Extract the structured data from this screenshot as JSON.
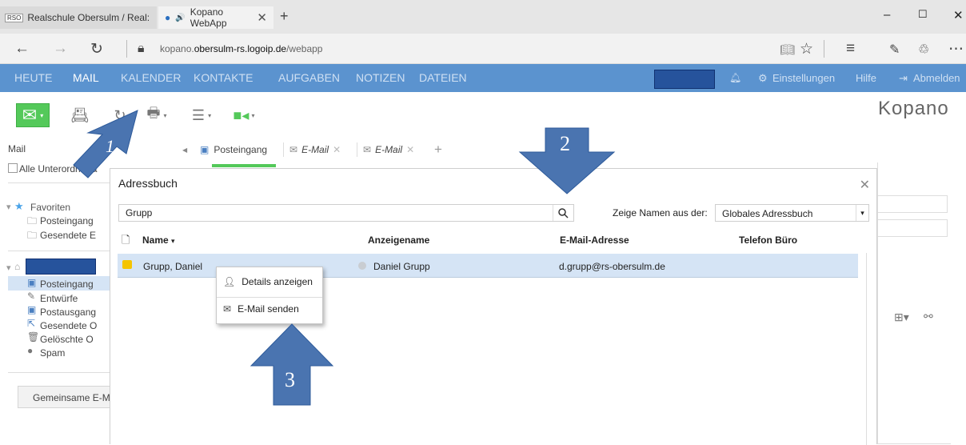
{
  "browser": {
    "tabs": [
      {
        "badge": "RSO",
        "title": "Realschule Obersulm / Real:"
      },
      {
        "title": "Kopano WebApp"
      }
    ],
    "url_prefix": "kopano.",
    "url_domain": "obersulm-rs.logoip.de",
    "url_suffix": "/webapp"
  },
  "menu": {
    "items": [
      "HEUTE",
      "MAIL",
      "KALENDER",
      "KONTAKTE",
      "AUFGABEN",
      "NOTIZEN",
      "DATEIEN"
    ],
    "active": "MAIL",
    "settings": "Einstellungen",
    "help": "Hilfe",
    "logout": "Abmelden"
  },
  "logo": "Kopano",
  "left_nav": {
    "title": "Mail",
    "all_subfolders": "Alle Unterordner a",
    "favorites": "Favoriten",
    "fav_items": [
      "Posteingang",
      "Gesendete E"
    ],
    "folders": [
      "Posteingang",
      "Entwürfe",
      "Postausgang",
      "Gesendete O",
      "Gelöschte O",
      "Spam"
    ],
    "shared_button": "Gemeinsame E-M"
  },
  "content_tabs": [
    "Posteingang",
    "E-Mail",
    "E-Mail"
  ],
  "dialog": {
    "title": "Adressbuch",
    "search_value": "Grupp",
    "show_names_label": "Zeige Namen aus der:",
    "addressbook_selected": "Globales Adressbuch",
    "columns": [
      "Name",
      "Anzeigename",
      "E-Mail-Adresse",
      "Telefon Büro"
    ],
    "rows": [
      {
        "name": "Grupp, Daniel",
        "display": "Daniel Grupp",
        "email": "d.grupp@rs-obersulm.de",
        "phone": ""
      }
    ]
  },
  "context_menu": {
    "items": [
      "Details anzeigen",
      "E-Mail senden"
    ]
  },
  "annotations": [
    "1",
    "2",
    "3"
  ],
  "colors": {
    "menu_bg": "#5b93cf",
    "selection": "#d5e4f5",
    "accent_green": "#54c95a",
    "arrow_fill": "#4a74b0"
  }
}
